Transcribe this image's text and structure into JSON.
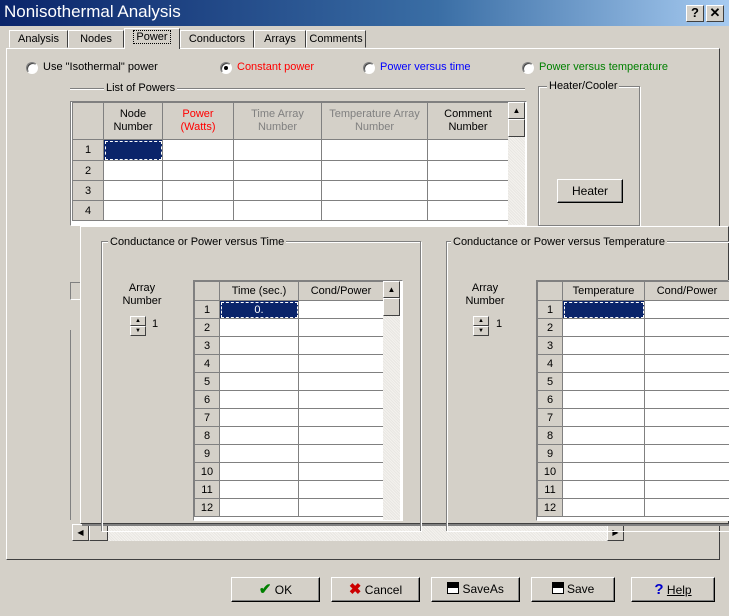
{
  "window": {
    "title": "Nonisothermal Analysis",
    "help_glyph": "?",
    "close_glyph": "✕"
  },
  "tabs": [
    {
      "label": "Analysis"
    },
    {
      "label": "Nodes"
    },
    {
      "label": "Power"
    },
    {
      "label": "Conductors"
    },
    {
      "label": "Arrays"
    },
    {
      "label": "Comments"
    }
  ],
  "active_tab": "Power",
  "power_mode": {
    "isothermal": "Use \"Isothermal\" power",
    "constant": "Constant power",
    "vs_time": "Power versus time",
    "vs_temp": "Power versus temperature",
    "selected": "constant"
  },
  "colors": {
    "constant": "#ff0000",
    "vs_time": "#0000ff",
    "vs_temp": "#008000",
    "selection": "#0a246a"
  },
  "powers": {
    "group_label": "List of Powers",
    "columns": [
      {
        "label": "Node\nNumber",
        "color": "#000000"
      },
      {
        "label": "Power\n(Watts)",
        "color": "#ff0000"
      },
      {
        "label": "Time Array\nNumber",
        "color": "#808080"
      },
      {
        "label": "Temperature Array\nNumber",
        "color": "#808080"
      },
      {
        "label": "Comment\nNumber",
        "color": "#000000"
      }
    ],
    "rows": [
      "1",
      "2",
      "3",
      "4"
    ]
  },
  "heater": {
    "group_label": "Heater/Cooler",
    "button": "Heater"
  },
  "time_panel": {
    "group_label": "Conductance or Power versus Time",
    "array_label": "Array\nNumber",
    "array_value": "1",
    "columns": [
      "Time (sec.)",
      "Cond/Power"
    ],
    "rows": [
      "1",
      "2",
      "3",
      "4",
      "5",
      "6",
      "7",
      "8",
      "9",
      "10",
      "11",
      "12"
    ],
    "first_value": "0."
  },
  "temp_panel": {
    "group_label": "Conductance or Power versus Temperature",
    "array_label": "Array\nNumber",
    "array_value": "1",
    "columns": [
      "Temperature",
      "Cond/Power"
    ],
    "rows": [
      "1",
      "2",
      "3",
      "4",
      "5",
      "6",
      "7",
      "8",
      "9",
      "10",
      "11",
      "12"
    ]
  },
  "buttons": {
    "ok": "OK",
    "cancel": "Cancel",
    "saveas": "SaveAs",
    "save": "Save",
    "help": "Help"
  }
}
